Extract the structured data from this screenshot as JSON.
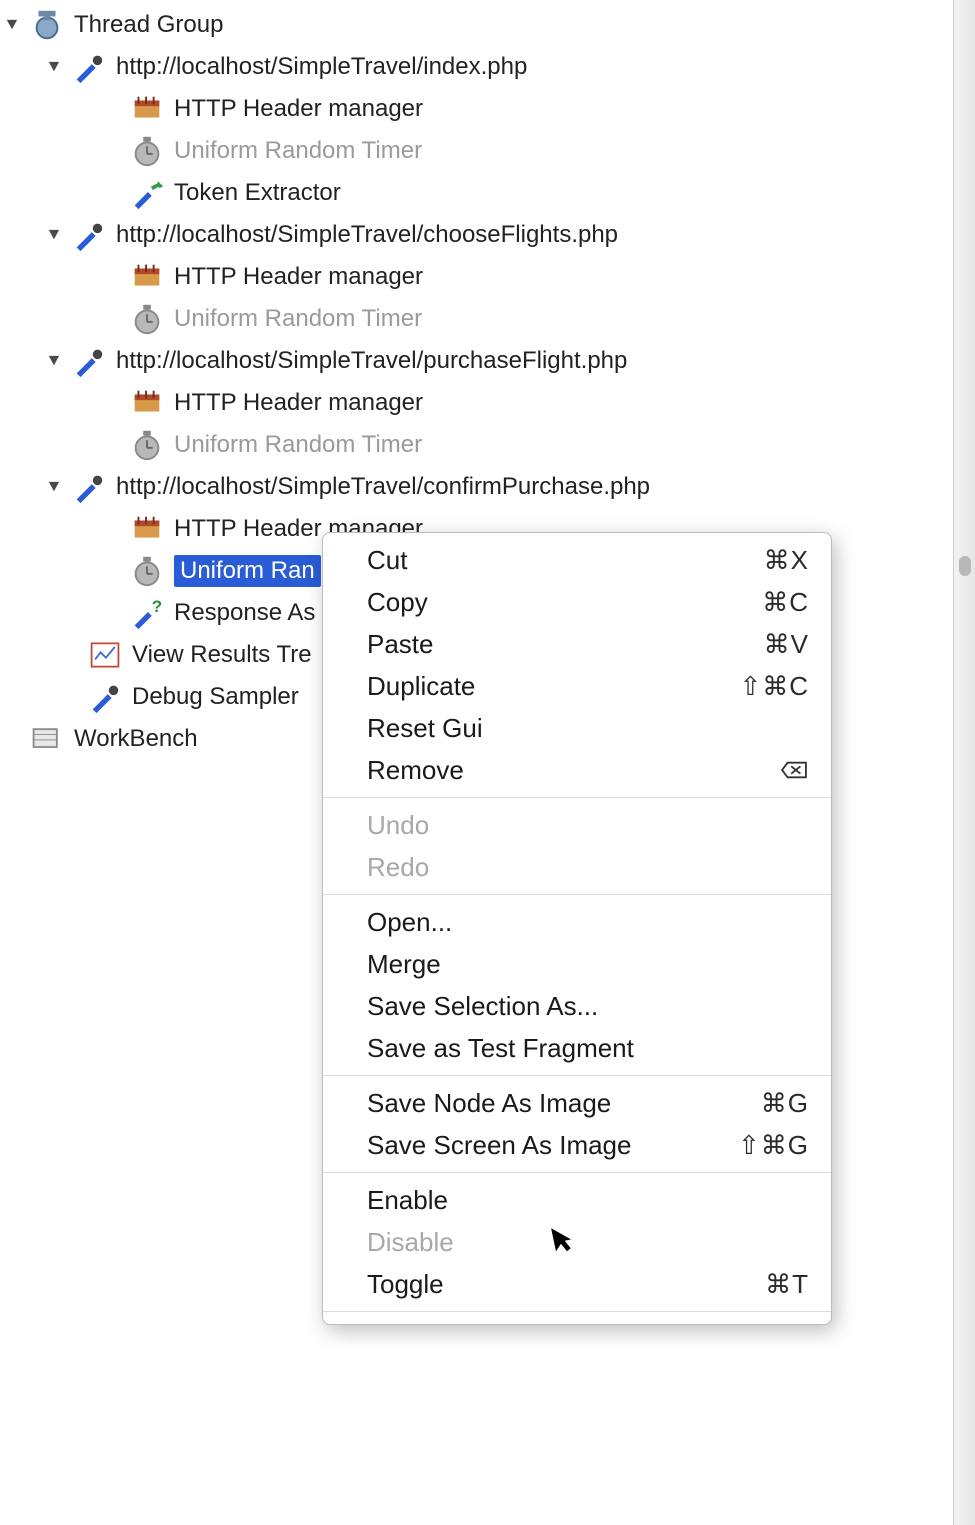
{
  "tree": {
    "thread_group": "Thread Group",
    "req1": "http://localhost/SimpleTravel/index.php",
    "req1_header": "HTTP Header manager",
    "req1_timer": "Uniform Random Timer",
    "req1_token": "Token Extractor",
    "req2": "http://localhost/SimpleTravel/chooseFlights.php",
    "req2_header": "HTTP Header manager",
    "req2_timer": "Uniform Random Timer",
    "req3": "http://localhost/SimpleTravel/purchaseFlight.php",
    "req3_header": "HTTP Header manager",
    "req3_timer": "Uniform Random Timer",
    "req4": "http://localhost/SimpleTravel/confirmPurchase.php",
    "req4_header": "HTTP Header manager",
    "req4_timer_sel": "Uniform Ran",
    "req4_assert": "Response As",
    "view_results": "View Results Tre",
    "debug_sampler": "Debug Sampler",
    "workbench": "WorkBench"
  },
  "menu": {
    "cut": "Cut",
    "cut_sc": "⌘X",
    "copy": "Copy",
    "copy_sc": "⌘C",
    "paste": "Paste",
    "paste_sc": "⌘V",
    "duplicate": "Duplicate",
    "duplicate_sc": "⇧⌘C",
    "reset_gui": "Reset Gui",
    "remove": "Remove",
    "remove_sc": "⌦",
    "undo": "Undo",
    "redo": "Redo",
    "open": "Open...",
    "merge": "Merge",
    "save_sel": "Save Selection As...",
    "save_frag": "Save as Test Fragment",
    "save_node_img": "Save Node As Image",
    "save_node_img_sc": "⌘G",
    "save_screen_img": "Save Screen As Image",
    "save_screen_img_sc": "⇧⌘G",
    "enable": "Enable",
    "disable": "Disable",
    "toggle": "Toggle",
    "toggle_sc": "⌘T"
  }
}
